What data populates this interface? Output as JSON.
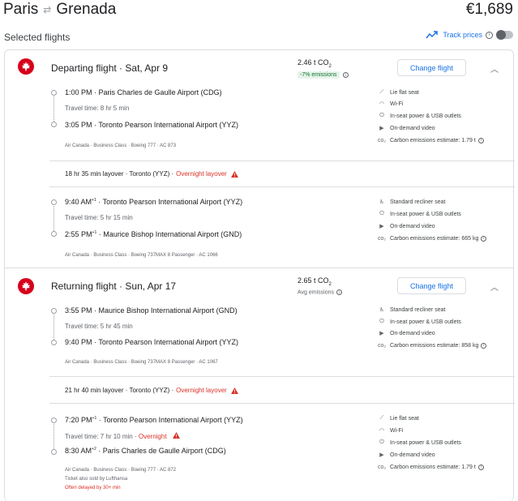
{
  "header": {
    "origin": "Paris",
    "destination": "Grenada",
    "price": "€1,689"
  },
  "selected_label": "Selected flights",
  "track": {
    "label": "Track prices",
    "info": "i"
  },
  "legs": [
    {
      "title": "Departing flight",
      "date": "Sat, Apr 9",
      "co2_value": "2.46 t CO",
      "co2_sub": "2",
      "emissions_note": "-7% emissions",
      "change_label": "Change flight",
      "segments": [
        {
          "dep_time": "1:00 PM",
          "dep_sup": "",
          "dep_airport": "Paris Charles de Gaulle Airport (CDG)",
          "travel_time": "Travel time: 8 hr 5 min",
          "overnight": "",
          "arr_time": "3:05 PM",
          "arr_sup": "",
          "arr_airport": "Toronto Pearson International Airport (YYZ)",
          "meta": [
            "Air Canada · Business Class · Boeing 777 · AC 873"
          ],
          "delay": "",
          "amenities": [
            {
              "icon": "seat-icon",
              "glyph": "⟋",
              "text": "Lie flat seat"
            },
            {
              "icon": "wifi-icon",
              "glyph": "◠",
              "text": "Wi-Fi"
            },
            {
              "icon": "power-icon",
              "glyph": "⏻",
              "text": "In-seat power & USB outlets"
            },
            {
              "icon": "video-icon",
              "glyph": "▶",
              "text": "On-demand video"
            },
            {
              "icon": "co2-icon",
              "glyph": "co₂",
              "text": "Carbon emissions estimate: 1.79 t"
            }
          ]
        },
        {
          "dep_time": "9:40 AM",
          "dep_sup": "+1",
          "dep_airport": "Toronto Pearson International Airport (YYZ)",
          "travel_time": "Travel time: 5 hr 15 min",
          "overnight": "",
          "arr_time": "2:55 PM",
          "arr_sup": "+1",
          "arr_airport": "Maurice Bishop International Airport (GND)",
          "meta": [
            "Air Canada · Business Class · Boeing 737MAX 8 Passenger · AC 1066"
          ],
          "delay": "",
          "amenities": [
            {
              "icon": "recliner-icon",
              "glyph": "♿",
              "text": "Standard recliner seat"
            },
            {
              "icon": "power-icon",
              "glyph": "⏻",
              "text": "In-seat power & USB outlets"
            },
            {
              "icon": "video-icon",
              "glyph": "▶",
              "text": "On-demand video"
            },
            {
              "icon": "co2-icon",
              "glyph": "co₂",
              "text": "Carbon emissions estimate: 665 kg"
            }
          ]
        }
      ],
      "layover": {
        "text": "18 hr 35 min layover · Toronto (YYZ) ·",
        "overnight": "Overnight layover"
      }
    },
    {
      "title": "Returning flight",
      "date": "Sun, Apr 17",
      "co2_value": "2.65 t CO",
      "co2_sub": "2",
      "emissions_note": "Avg emissions",
      "change_label": "Change flight",
      "segments": [
        {
          "dep_time": "3:55 PM",
          "dep_sup": "",
          "dep_airport": "Maurice Bishop International Airport (GND)",
          "travel_time": "Travel time: 5 hr 45 min",
          "overnight": "",
          "arr_time": "9:40 PM",
          "arr_sup": "",
          "arr_airport": "Toronto Pearson International Airport (YYZ)",
          "meta": [
            "Air Canada · Business Class · Boeing 737MAX 8 Passenger · AC 1067"
          ],
          "delay": "",
          "amenities": [
            {
              "icon": "recliner-icon",
              "glyph": "♿",
              "text": "Standard recliner seat"
            },
            {
              "icon": "power-icon",
              "glyph": "⏻",
              "text": "In-seat power & USB outlets"
            },
            {
              "icon": "video-icon",
              "glyph": "▶",
              "text": "On-demand video"
            },
            {
              "icon": "co2-icon",
              "glyph": "co₂",
              "text": "Carbon emissions estimate: 858 kg"
            }
          ]
        },
        {
          "dep_time": "7:20 PM",
          "dep_sup": "+1",
          "dep_airport": "Toronto Pearson International Airport (YYZ)",
          "travel_time": "Travel time: 7 hr 10 min ·",
          "overnight": "Overnight",
          "arr_time": "8:30 AM",
          "arr_sup": "+2",
          "arr_airport": "Paris Charles de Gaulle Airport (CDG)",
          "meta": [
            "Air Canada · Business Class · Boeing 777 · AC 872",
            "Ticket also sold by Lufthansa"
          ],
          "delay": "Often delayed by 30+ min",
          "amenities": [
            {
              "icon": "seat-icon",
              "glyph": "⟋",
              "text": "Lie flat seat"
            },
            {
              "icon": "wifi-icon",
              "glyph": "◠",
              "text": "Wi-Fi"
            },
            {
              "icon": "power-icon",
              "glyph": "⏻",
              "text": "In-seat power & USB outlets"
            },
            {
              "icon": "video-icon",
              "glyph": "▶",
              "text": "On-demand video"
            },
            {
              "icon": "co2-icon",
              "glyph": "co₂",
              "text": "Carbon emissions estimate: 1.79 t"
            }
          ]
        }
      ],
      "layover": {
        "text": "21 hr 40 min layover · Toronto (YYZ) ·",
        "overnight": "Overnight layover"
      }
    }
  ],
  "colors": {
    "accent": "#1a73e8",
    "warning": "#d93025",
    "airline": "#d6001c",
    "positive": "#137333"
  }
}
